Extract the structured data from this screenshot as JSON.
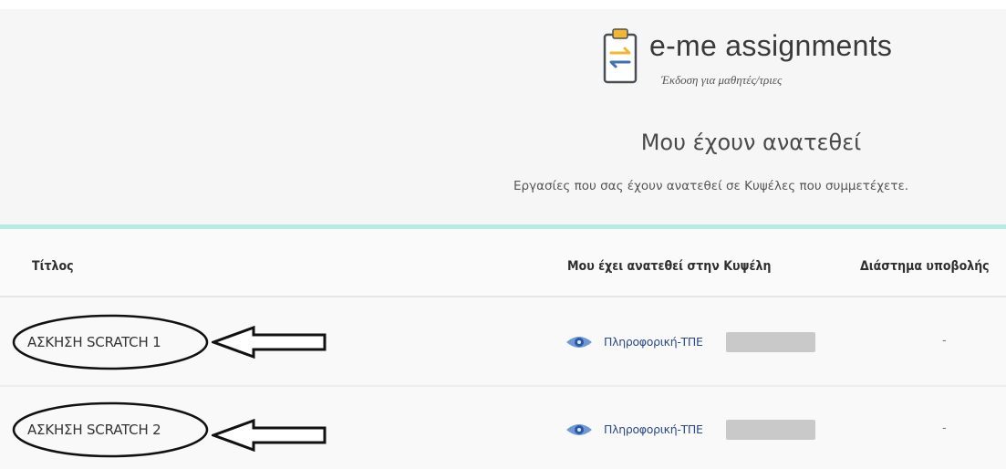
{
  "header": {
    "app_title": "e-me assignments",
    "app_subtitle": "Έκδοση για μαθητές/τριες",
    "page_heading": "Μου έχουν ανατεθεί",
    "page_description": "Εργασίες που σας έχουν ανατεθεί σε Κυψέλες που συμμετέχετε.",
    "logo_icon": "clipboard-swap-icon",
    "accent_color": "#b7ece5"
  },
  "table": {
    "columns": [
      "Τίτλος",
      "Μου έχει ανατεθεί στην Κυψέλη",
      "Διάστημα υποβολής"
    ],
    "rows": [
      {
        "title": "ΑΣΚΗΣΗ SCRATCH 1",
        "course": "Πληροφορική-ΤΠΕ",
        "course_icon": "eye-icon",
        "interval": "-"
      },
      {
        "title": "ΑΣΚΗΣΗ SCRATCH 2",
        "course": "Πληροφορική-ΤΠΕ",
        "course_icon": "eye-icon",
        "interval": "-"
      }
    ]
  },
  "colors": {
    "header_bg": "#f6f6f6",
    "link": "#2a4a8a",
    "eye_icon": "#3f6fb5"
  }
}
